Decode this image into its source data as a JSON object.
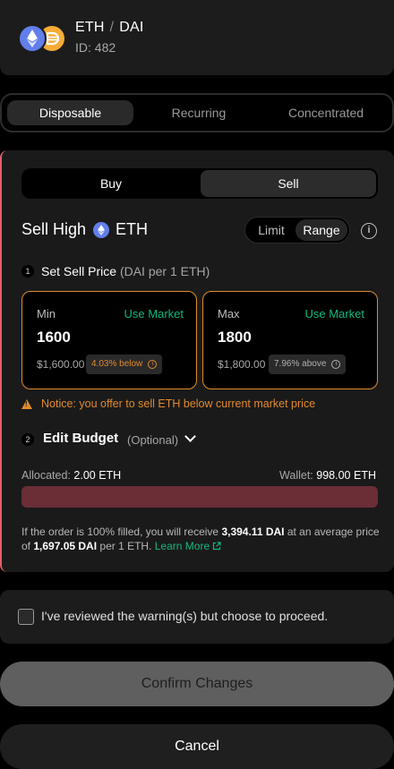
{
  "pair": {
    "base": "ETH",
    "separator": "/",
    "quote": "DAI",
    "id_label": "ID: 482"
  },
  "strategy_tabs": [
    "Disposable",
    "Recurring",
    "Concentrated"
  ],
  "side_toggle": {
    "buy": "Buy",
    "sell": "Sell",
    "selected": "Sell"
  },
  "order": {
    "title_prefix": "Sell High",
    "token": "ETH",
    "modes": [
      "Limit",
      "Range"
    ],
    "selected_mode": "Range"
  },
  "step1": {
    "number": "1",
    "label": "Set Sell Price",
    "unit": "(DAI per 1 ETH)"
  },
  "min_price": {
    "label": "Min",
    "use_market": "Use Market",
    "value": "1600",
    "fiat": "$1,600.00",
    "pct": "4.03% below"
  },
  "max_price": {
    "label": "Max",
    "use_market": "Use Market",
    "value": "1800",
    "fiat": "$1,800.00",
    "pct": "7.96% above"
  },
  "notice": "Notice: you offer to sell ETH below current market price",
  "step2": {
    "number": "2",
    "label": "Edit Budget",
    "optional": "(Optional)"
  },
  "budget": {
    "allocated_label": "Allocated:",
    "allocated_value": "2.00 ETH",
    "wallet_label": "Wallet:",
    "wallet_value": "998.00 ETH"
  },
  "summary": {
    "part1": "If the order is 100% filled, you will receive ",
    "receive": "3,394.11 DAI",
    "part2": " at an average price of ",
    "price": "1,697.05 DAI",
    "part3": " per 1 ETH. ",
    "learn_more": "Learn More"
  },
  "warning_ack": "I've reviewed the warning(s) but choose to proceed.",
  "confirm_label": "Confirm Changes",
  "cancel_label": "Cancel",
  "colors": {
    "accent_green": "#10b981",
    "warning_orange": "#e08a2d",
    "sell_red": "#e55d6d",
    "eth": "#627eea",
    "dai": "#f5ac37"
  }
}
